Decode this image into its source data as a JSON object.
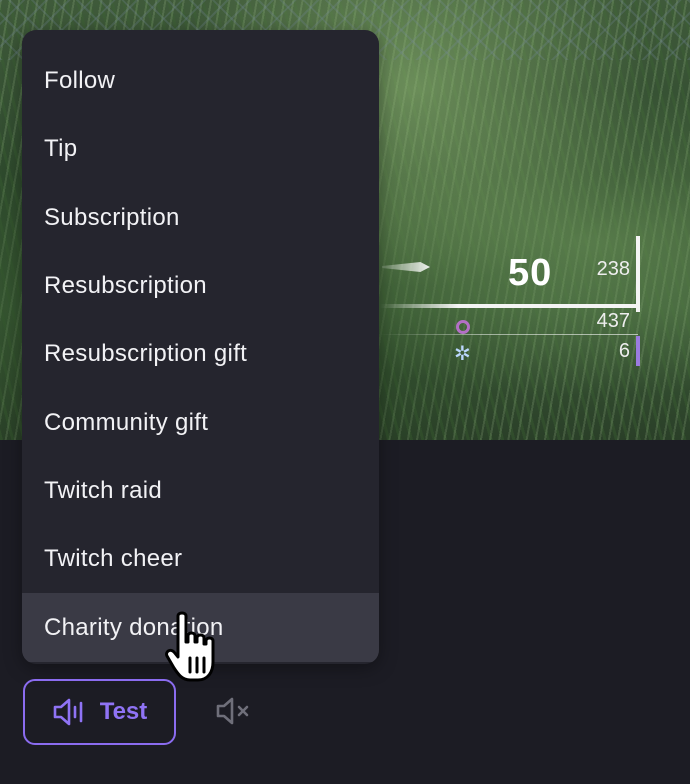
{
  "menu": {
    "items": [
      {
        "label": "Follow"
      },
      {
        "label": "Tip"
      },
      {
        "label": "Subscription"
      },
      {
        "label": "Resubscription"
      },
      {
        "label": "Resubscription gift"
      },
      {
        "label": "Community gift"
      },
      {
        "label": "Twitch raid"
      },
      {
        "label": "Twitch cheer"
      },
      {
        "label": "Charity donation"
      }
    ],
    "hovered_index": 8
  },
  "buttons": {
    "test_label": "Test",
    "test_icon": "speaker-wave-icon",
    "mute_icon": "speaker-muted-icon"
  },
  "game_preview": {
    "magazine": "50",
    "reserve": "238",
    "secondary_value": "437",
    "tertiary_value": "6"
  },
  "colors": {
    "accent": "#8b6cf0",
    "menu_bg": "#25252e",
    "menu_hover": "#3a3a45",
    "page_bg": "#1c1c24"
  }
}
